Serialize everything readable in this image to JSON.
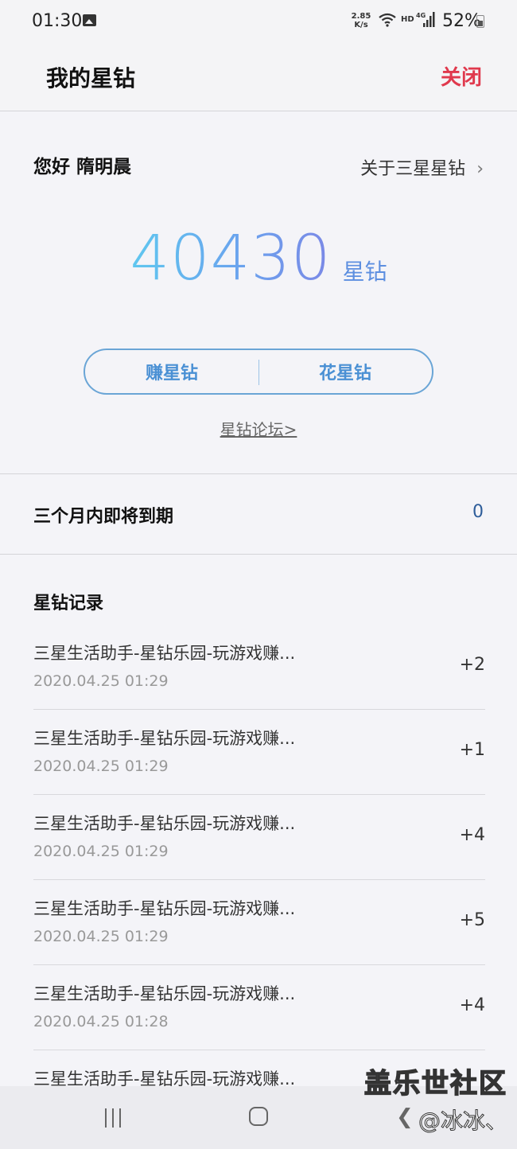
{
  "status_bar": {
    "time": "01:30",
    "net_speed_value": "2.85",
    "net_speed_unit": "K/s",
    "hd": "HD",
    "network": "4G",
    "battery": "52%"
  },
  "header": {
    "title": "我的星钻",
    "close_label": "关闭"
  },
  "summary": {
    "greeting": "您好  隋明晨",
    "about_label": "关于三星星钻",
    "balance": "40430",
    "balance_unit": "星钻",
    "earn_label": "赚星钻",
    "spend_label": "花星钻",
    "forum_label": "星钻论坛>"
  },
  "expiry": {
    "label": "三个月内即将到期",
    "value": "0"
  },
  "records": {
    "title": "星钻记录",
    "items": [
      {
        "title": "三星生活助手-星钻乐园-玩游戏赚...",
        "time": "2020.04.25 01:29",
        "points": "+2"
      },
      {
        "title": "三星生活助手-星钻乐园-玩游戏赚...",
        "time": "2020.04.25 01:29",
        "points": "+1"
      },
      {
        "title": "三星生活助手-星钻乐园-玩游戏赚...",
        "time": "2020.04.25 01:29",
        "points": "+4"
      },
      {
        "title": "三星生活助手-星钻乐园-玩游戏赚...",
        "time": "2020.04.25 01:29",
        "points": "+5"
      },
      {
        "title": "三星生活助手-星钻乐园-玩游戏赚...",
        "time": "2020.04.25 01:28",
        "points": "+4"
      },
      {
        "title": "三星生活助手-星钻乐园-玩游戏赚...",
        "time": "",
        "points": ""
      }
    ]
  },
  "watermark": {
    "line1": "盖乐世社区",
    "line2": "@冰冰、"
  },
  "colors": {
    "accent_red": "#e0394d",
    "accent_blue": "#4a90d4",
    "expiry_value": "#2e5d9a"
  },
  "icons": {
    "status": [
      "gallery-icon",
      "wifi-icon",
      "signal-icon",
      "battery-icon"
    ],
    "nav": [
      "recents-icon",
      "home-icon",
      "back-icon"
    ]
  }
}
